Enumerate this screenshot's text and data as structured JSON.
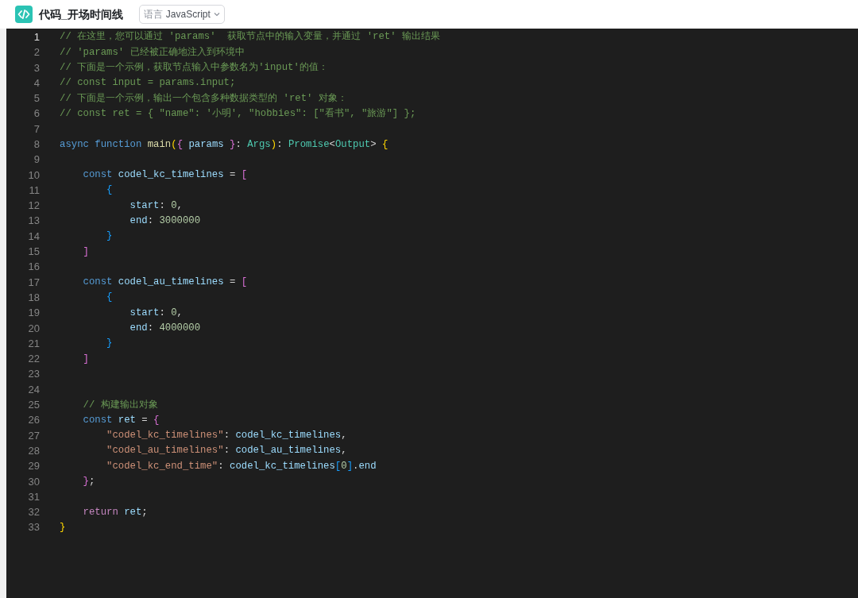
{
  "header": {
    "title": "代码_开场时间线",
    "language_select": {
      "label": "语言",
      "value": "JavaScript"
    }
  },
  "editor": {
    "lines": [
      {
        "number": "1",
        "selected": true,
        "segments": [
          {
            "kind": "comment",
            "text": "// 在这里，您可以通过 'params'  获取节点中的输入变量，并通过 'ret' 输出结果"
          }
        ]
      },
      {
        "number": "2",
        "selected": false,
        "segments": [
          {
            "kind": "comment",
            "text": "// 'params' 已经被正确地注入到环境中"
          }
        ]
      },
      {
        "number": "3",
        "selected": false,
        "segments": [
          {
            "kind": "comment",
            "text": "// 下面是一个示例，获取节点输入中参数名为'input'的值："
          }
        ]
      },
      {
        "number": "4",
        "selected": false,
        "segments": [
          {
            "kind": "comment",
            "text": "// const input = params.input;"
          }
        ]
      },
      {
        "number": "5",
        "selected": false,
        "segments": [
          {
            "kind": "comment",
            "text": "// 下面是一个示例，输出一个包含多种数据类型的 'ret' 对象："
          }
        ]
      },
      {
        "number": "6",
        "selected": false,
        "segments": [
          {
            "kind": "comment",
            "text": "// const ret = { \"name\": '小明', \"hobbies\": [\"看书\", \"旅游\"] };"
          }
        ]
      },
      {
        "number": "7",
        "selected": false
      },
      {
        "number": "8",
        "selected": false,
        "segments": [
          {
            "kind": "keyword",
            "text": "async "
          },
          {
            "kind": "keyword",
            "text": "function "
          },
          {
            "kind": "func",
            "text": "main"
          },
          {
            "kind": "bracket1",
            "text": "("
          },
          {
            "kind": "bracket2",
            "text": "{ "
          },
          {
            "kind": "var",
            "text": "params "
          },
          {
            "kind": "bracket2",
            "text": "}"
          },
          {
            "kind": "plain",
            "text": ": "
          },
          {
            "kind": "type",
            "text": "Args"
          },
          {
            "kind": "bracket1",
            "text": ")"
          },
          {
            "kind": "plain",
            "text": ": "
          },
          {
            "kind": "type",
            "text": "Promise"
          },
          {
            "kind": "plain",
            "text": "<"
          },
          {
            "kind": "type",
            "text": "Output"
          },
          {
            "kind": "plain",
            "text": "> "
          },
          {
            "kind": "bracket1",
            "text": "{"
          }
        ]
      },
      {
        "number": "9",
        "selected": false
      },
      {
        "number": "10",
        "selected": false,
        "segments": [
          {
            "kind": "keyword",
            "text": "    const "
          },
          {
            "kind": "var",
            "text": "codel_kc_timelines "
          },
          {
            "kind": "plain",
            "text": "= "
          },
          {
            "kind": "bracket2",
            "text": "["
          }
        ]
      },
      {
        "number": "11",
        "selected": false,
        "segments": [
          {
            "kind": "bracket3",
            "text": "        {"
          }
        ]
      },
      {
        "number": "12",
        "selected": false,
        "segments": [
          {
            "kind": "var",
            "text": "            start"
          },
          {
            "kind": "plain",
            "text": ": "
          },
          {
            "kind": "number",
            "text": "0"
          },
          {
            "kind": "plain",
            "text": ","
          }
        ]
      },
      {
        "number": "13",
        "selected": false,
        "segments": [
          {
            "kind": "var",
            "text": "            end"
          },
          {
            "kind": "plain",
            "text": ": "
          },
          {
            "kind": "number",
            "text": "3000000"
          }
        ]
      },
      {
        "number": "14",
        "selected": false,
        "segments": [
          {
            "kind": "bracket3",
            "text": "        }"
          }
        ]
      },
      {
        "number": "15",
        "selected": false,
        "segments": [
          {
            "kind": "bracket2",
            "text": "    ]"
          }
        ]
      },
      {
        "number": "16",
        "selected": false
      },
      {
        "number": "17",
        "selected": false,
        "segments": [
          {
            "kind": "keyword",
            "text": "    const "
          },
          {
            "kind": "var",
            "text": "codel_au_timelines "
          },
          {
            "kind": "plain",
            "text": "= "
          },
          {
            "kind": "bracket2",
            "text": "["
          }
        ]
      },
      {
        "number": "18",
        "selected": false,
        "segments": [
          {
            "kind": "bracket3",
            "text": "        {"
          }
        ]
      },
      {
        "number": "19",
        "selected": false,
        "segments": [
          {
            "kind": "var",
            "text": "            start"
          },
          {
            "kind": "plain",
            "text": ": "
          },
          {
            "kind": "number",
            "text": "0"
          },
          {
            "kind": "plain",
            "text": ","
          }
        ]
      },
      {
        "number": "20",
        "selected": false,
        "segments": [
          {
            "kind": "var",
            "text": "            end"
          },
          {
            "kind": "plain",
            "text": ": "
          },
          {
            "kind": "number",
            "text": "4000000"
          }
        ]
      },
      {
        "number": "21",
        "selected": false,
        "segments": [
          {
            "kind": "bracket3",
            "text": "        }"
          }
        ]
      },
      {
        "number": "22",
        "selected": false,
        "segments": [
          {
            "kind": "bracket2",
            "text": "    ]"
          }
        ]
      },
      {
        "number": "23",
        "selected": false
      },
      {
        "number": "24",
        "selected": false
      },
      {
        "number": "25",
        "selected": false,
        "segments": [
          {
            "kind": "comment",
            "text": "    // 构建输出对象"
          }
        ]
      },
      {
        "number": "26",
        "selected": false,
        "segments": [
          {
            "kind": "keyword",
            "text": "    const "
          },
          {
            "kind": "var",
            "text": "ret "
          },
          {
            "kind": "plain",
            "text": "= "
          },
          {
            "kind": "bracket2",
            "text": "{"
          }
        ]
      },
      {
        "number": "27",
        "selected": false,
        "segments": [
          {
            "kind": "string",
            "text": "        \"codel_kc_timelines\""
          },
          {
            "kind": "plain",
            "text": ": "
          },
          {
            "kind": "var",
            "text": "codel_kc_timelines"
          },
          {
            "kind": "plain",
            "text": ","
          }
        ]
      },
      {
        "number": "28",
        "selected": false,
        "segments": [
          {
            "kind": "string",
            "text": "        \"codel_au_timelines\""
          },
          {
            "kind": "plain",
            "text": ": "
          },
          {
            "kind": "var",
            "text": "codel_au_timelines"
          },
          {
            "kind": "plain",
            "text": ","
          }
        ]
      },
      {
        "number": "29",
        "selected": false,
        "segments": [
          {
            "kind": "string",
            "text": "        \"codel_kc_end_time\""
          },
          {
            "kind": "plain",
            "text": ": "
          },
          {
            "kind": "var",
            "text": "codel_kc_timelines"
          },
          {
            "kind": "bracket3",
            "text": "["
          },
          {
            "kind": "number",
            "text": "0"
          },
          {
            "kind": "bracket3",
            "text": "]"
          },
          {
            "kind": "plain",
            "text": "."
          },
          {
            "kind": "var",
            "text": "end"
          }
        ]
      },
      {
        "number": "30",
        "selected": false,
        "segments": [
          {
            "kind": "bracket2",
            "text": "    }"
          },
          {
            "kind": "plain",
            "text": ";"
          }
        ]
      },
      {
        "number": "31",
        "selected": false
      },
      {
        "number": "32",
        "selected": false,
        "segments": [
          {
            "kind": "control",
            "text": "    return "
          },
          {
            "kind": "var",
            "text": "ret"
          },
          {
            "kind": "plain",
            "text": ";"
          }
        ]
      },
      {
        "number": "33",
        "selected": false,
        "segments": [
          {
            "kind": "bracket1",
            "text": "}"
          }
        ]
      }
    ]
  }
}
